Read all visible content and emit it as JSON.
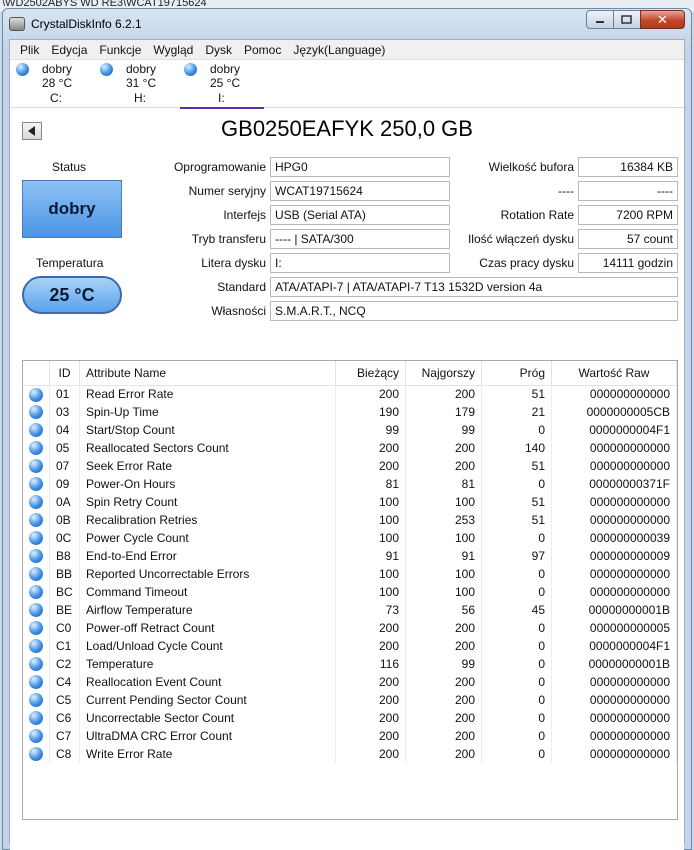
{
  "background_title": "\\WD2502ABYS WD RE3\\WCAT19715624",
  "window": {
    "title": "CrystalDiskInfo 6.2.1",
    "close_glyph": "✕"
  },
  "menu": [
    "Plik",
    "Edycja",
    "Funkcje",
    "Wygląd",
    "Dysk",
    "Pomoc",
    "Język(Language)"
  ],
  "disks": [
    {
      "status": "dobry",
      "temp": "28 °C",
      "letter": "C:"
    },
    {
      "status": "dobry",
      "temp": "31 °C",
      "letter": "H:"
    },
    {
      "status": "dobry",
      "temp": "25 °C",
      "letter": "I:"
    }
  ],
  "drive": {
    "model": "GB0250EAFYK 250,0 GB",
    "status_label": "Status",
    "status_value": "dobry",
    "temp_label": "Temperatura",
    "temp_value": "25 °C",
    "firmware_label": "Oprogramowanie",
    "firmware": "HPG0",
    "serial_label": "Numer seryjny",
    "serial": "WCAT19715624",
    "interface_label": "Interfejs",
    "interface": "USB (Serial ATA)",
    "transfer_label": "Tryb transferu",
    "transfer": "---- | SATA/300",
    "letter_label": "Litera dysku",
    "letter": "I:",
    "standard_label": "Standard",
    "standard": "ATA/ATAPI-7 | ATA/ATAPI-7 T13 1532D version 4a",
    "features_label": "Własności",
    "features": "S.M.A.R.T., NCQ",
    "buffer_label": "Wielkość bufora",
    "buffer": "16384 KB",
    "blank_label": "----",
    "blank_value": "----",
    "rotation_label": "Rotation Rate",
    "rotation": "7200 RPM",
    "power_count_label": "Ilość włączeń dysku",
    "power_count": "57 count",
    "power_hours_label": "Czas pracy dysku",
    "power_hours": "14111 godzin"
  },
  "smart": {
    "headers": {
      "id": "ID",
      "name": "Attribute Name",
      "current": "Bieżący",
      "worst": "Najgorszy",
      "threshold": "Próg",
      "raw": "Wartość Raw"
    },
    "rows": [
      {
        "id": "01",
        "name": "Read Error Rate",
        "current": "200",
        "worst": "200",
        "threshold": "51",
        "raw": "000000000000"
      },
      {
        "id": "03",
        "name": "Spin-Up Time",
        "current": "190",
        "worst": "179",
        "threshold": "21",
        "raw": "0000000005CB"
      },
      {
        "id": "04",
        "name": "Start/Stop Count",
        "current": "99",
        "worst": "99",
        "threshold": "0",
        "raw": "0000000004F1"
      },
      {
        "id": "05",
        "name": "Reallocated Sectors Count",
        "current": "200",
        "worst": "200",
        "threshold": "140",
        "raw": "000000000000"
      },
      {
        "id": "07",
        "name": "Seek Error Rate",
        "current": "200",
        "worst": "200",
        "threshold": "51",
        "raw": "000000000000"
      },
      {
        "id": "09",
        "name": "Power-On Hours",
        "current": "81",
        "worst": "81",
        "threshold": "0",
        "raw": "00000000371F"
      },
      {
        "id": "0A",
        "name": "Spin Retry Count",
        "current": "100",
        "worst": "100",
        "threshold": "51",
        "raw": "000000000000"
      },
      {
        "id": "0B",
        "name": "Recalibration Retries",
        "current": "100",
        "worst": "253",
        "threshold": "51",
        "raw": "000000000000"
      },
      {
        "id": "0C",
        "name": "Power Cycle Count",
        "current": "100",
        "worst": "100",
        "threshold": "0",
        "raw": "000000000039"
      },
      {
        "id": "B8",
        "name": "End-to-End Error",
        "current": "91",
        "worst": "91",
        "threshold": "97",
        "raw": "000000000009"
      },
      {
        "id": "BB",
        "name": "Reported Uncorrectable Errors",
        "current": "100",
        "worst": "100",
        "threshold": "0",
        "raw": "000000000000"
      },
      {
        "id": "BC",
        "name": "Command Timeout",
        "current": "100",
        "worst": "100",
        "threshold": "0",
        "raw": "000000000000"
      },
      {
        "id": "BE",
        "name": "Airflow Temperature",
        "current": "73",
        "worst": "56",
        "threshold": "45",
        "raw": "00000000001B"
      },
      {
        "id": "C0",
        "name": "Power-off Retract Count",
        "current": "200",
        "worst": "200",
        "threshold": "0",
        "raw": "000000000005"
      },
      {
        "id": "C1",
        "name": "Load/Unload Cycle Count",
        "current": "200",
        "worst": "200",
        "threshold": "0",
        "raw": "0000000004F1"
      },
      {
        "id": "C2",
        "name": "Temperature",
        "current": "116",
        "worst": "99",
        "threshold": "0",
        "raw": "00000000001B"
      },
      {
        "id": "C4",
        "name": "Reallocation Event Count",
        "current": "200",
        "worst": "200",
        "threshold": "0",
        "raw": "000000000000"
      },
      {
        "id": "C5",
        "name": "Current Pending Sector Count",
        "current": "200",
        "worst": "200",
        "threshold": "0",
        "raw": "000000000000"
      },
      {
        "id": "C6",
        "name": "Uncorrectable Sector Count",
        "current": "200",
        "worst": "200",
        "threshold": "0",
        "raw": "000000000000"
      },
      {
        "id": "C7",
        "name": "UltraDMA CRC Error Count",
        "current": "200",
        "worst": "200",
        "threshold": "0",
        "raw": "000000000000"
      },
      {
        "id": "C8",
        "name": "Write Error Rate",
        "current": "200",
        "worst": "200",
        "threshold": "0",
        "raw": "000000000000"
      }
    ]
  },
  "colors": {
    "good_status": "#4a94e6",
    "active_tab_underline": "#5a2db0"
  }
}
